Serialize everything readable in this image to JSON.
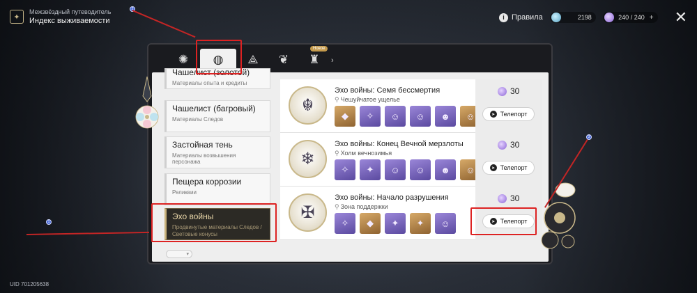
{
  "header": {
    "guide_subtitle": "Межзвёздный путеводитель",
    "guide_title": "Индекс выживаемости"
  },
  "top_right": {
    "rules_label": "Правила",
    "currency1": "2198",
    "currency2": "240 / 240",
    "plus": "+"
  },
  "tabs": [
    {
      "icon": "gear-emblem-icon"
    },
    {
      "icon": "shield-emblem-icon",
      "active": true
    },
    {
      "icon": "triangle-emblem-icon"
    },
    {
      "icon": "lotus-emblem-icon"
    },
    {
      "icon": "tower-emblem-icon",
      "badge": "Новое"
    }
  ],
  "categories": [
    {
      "title": "Чашелист (золотой)",
      "sub": "Материалы опыта и кредиты"
    },
    {
      "title": "Чашелист (багровый)",
      "sub": "Материалы Следов"
    },
    {
      "title": "Застойная тень",
      "sub": "Материалы возвышения персонажа"
    },
    {
      "title": "Пещера коррозии",
      "sub": "Реликвии"
    },
    {
      "title": "Эхо войны",
      "sub": "Продвинутые материалы Следов / Световые конусы"
    }
  ],
  "entries": [
    {
      "title": "Эхо войны: Семя бессмертия",
      "location": "Чешуйчатое ущелье",
      "cost": "30",
      "teleport": "Телепорт"
    },
    {
      "title": "Эхо войны: Конец Вечной мерзлоты",
      "location": "Холм вечнозимья",
      "cost": "30",
      "teleport": "Телепорт"
    },
    {
      "title": "Эхо войны: Начало разрушения",
      "location": "Зона поддержки",
      "cost": "30",
      "teleport": "Телепорт"
    }
  ],
  "markers": {
    "m1": "1",
    "m2": "2",
    "m3": "3"
  },
  "uid": "UID 701205638"
}
